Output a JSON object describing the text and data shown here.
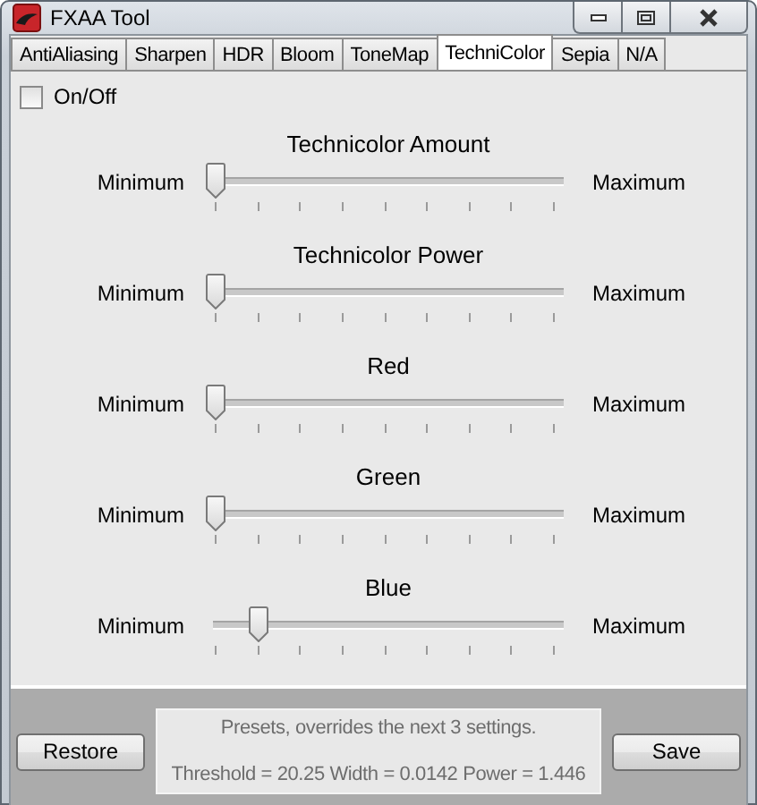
{
  "window": {
    "title": "FXAA Tool"
  },
  "tabs": [
    {
      "label": "AntiAliasing",
      "selected": false
    },
    {
      "label": "Sharpen",
      "selected": false
    },
    {
      "label": "HDR",
      "selected": false
    },
    {
      "label": "Bloom",
      "selected": false
    },
    {
      "label": "ToneMap",
      "selected": false
    },
    {
      "label": "TechniColor",
      "selected": true
    },
    {
      "label": "Sepia",
      "selected": false
    },
    {
      "label": "N/A",
      "selected": false
    }
  ],
  "toggle": {
    "label": "On/Off",
    "checked": false
  },
  "sliders": [
    {
      "title": "Technicolor Amount",
      "min_label": "Minimum",
      "max_label": "Maximum",
      "level": 0
    },
    {
      "title": "Technicolor Power",
      "min_label": "Minimum",
      "max_label": "Maximum",
      "level": 0
    },
    {
      "title": "Red",
      "min_label": "Minimum",
      "max_label": "Maximum",
      "level": 0
    },
    {
      "title": "Green",
      "min_label": "Minimum",
      "max_label": "Maximum",
      "level": 0
    },
    {
      "title": "Blue",
      "min_label": "Minimum",
      "max_label": "Maximum",
      "level": 0.125
    }
  ],
  "footer": {
    "restore_button": "Restore",
    "presets_note": "Presets, overrides the next 3 settings.",
    "presets_values": "Threshold = 20.25 Width = 0.0142 Power = 1.446",
    "save_button": "Save"
  }
}
